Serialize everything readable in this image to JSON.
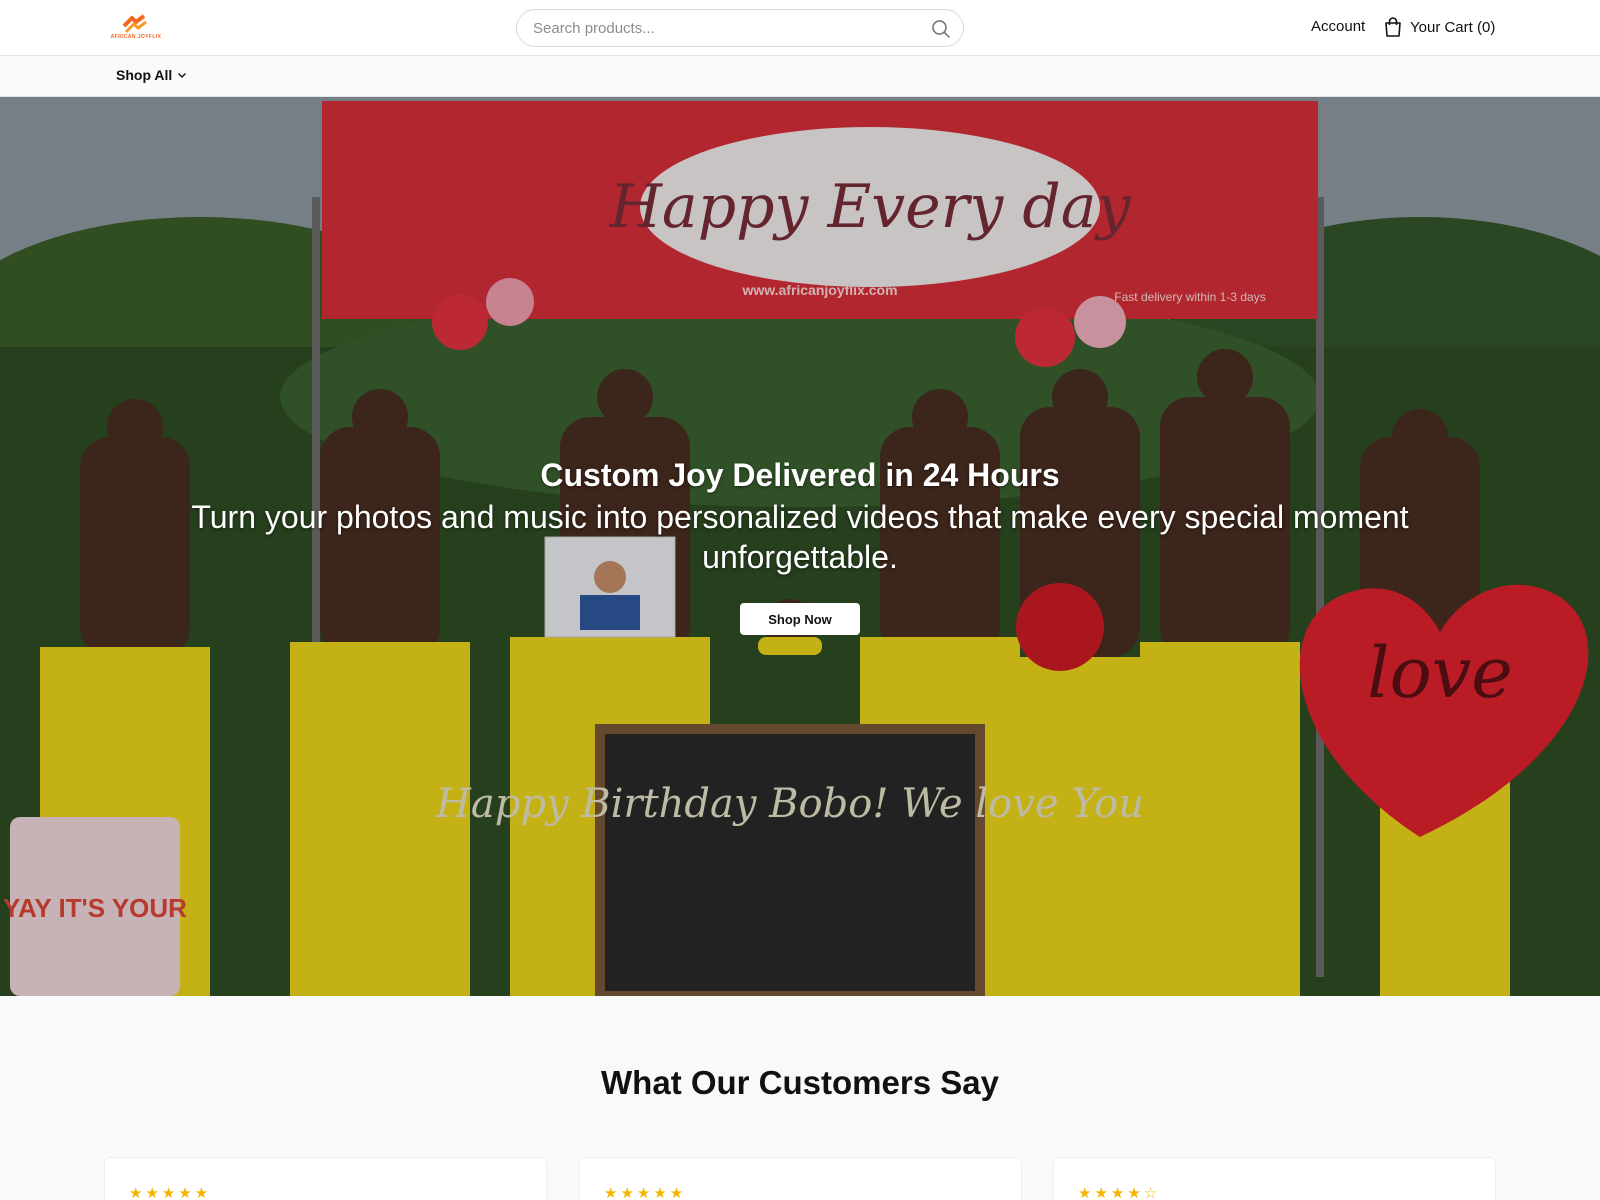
{
  "header": {
    "logo_text": "AFRICAN JOYFLIX",
    "logo_icon": "logo-icon",
    "search_placeholder": "Search products...",
    "search_icon": "search-icon",
    "account_label": "Account",
    "cart_label": "Your Cart (0)",
    "cart_icon": "shopping-bag-icon"
  },
  "nav": {
    "shop_all_label": "Shop All",
    "shop_all_icon": "chevron-down-icon"
  },
  "hero": {
    "title": "Custom Joy Delivered in 24 Hours",
    "subtitle": "Turn your photos and music into personalized videos that make every special moment unforgettable.",
    "button_label": "Shop Now",
    "banner_headline": "Happy Every day",
    "banner_url": "www.africanjoyflix.com",
    "banner_delivery": "Fast delivery within 1-3 days",
    "chalkboard_text": "Happy Birthday Bobo! We love You",
    "balloon_text": "love",
    "cake_text": "YAY IT'S YOUR"
  },
  "testimonials": {
    "title": "What Our Customers Say",
    "cards": [
      {
        "rating": 5,
        "stars": "★★★★★"
      },
      {
        "rating": 5,
        "stars": "★★★★★"
      },
      {
        "rating": 4,
        "stars": "★★★★☆"
      }
    ]
  },
  "colors": {
    "brand_orange": "#f26722",
    "star_yellow": "#f5b400",
    "banner_red": "#d9303a",
    "pants_yellow": "#f0d81a"
  }
}
